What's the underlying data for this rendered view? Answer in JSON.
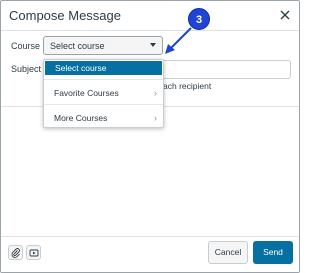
{
  "dialog": {
    "title": "Compose Message"
  },
  "callout": {
    "number": "3"
  },
  "form": {
    "course_label": "Course",
    "course_selected": "Select course",
    "subject_label": "Subject",
    "recipient_text": "ach recipient"
  },
  "dropdown": {
    "items": [
      {
        "label": "Select course",
        "selected": true
      },
      {
        "label": "Favorite Courses",
        "submenu": true
      },
      {
        "label": "More Courses",
        "submenu": true
      }
    ]
  },
  "footer": {
    "cancel_label": "Cancel",
    "send_label": "Send"
  },
  "colors": {
    "accent": "#0770a3",
    "callout": "#1f44d6"
  },
  "icons": [
    "close-icon",
    "chevron-down-icon",
    "chevron-right-icon",
    "paperclip-icon",
    "media-icon"
  ]
}
